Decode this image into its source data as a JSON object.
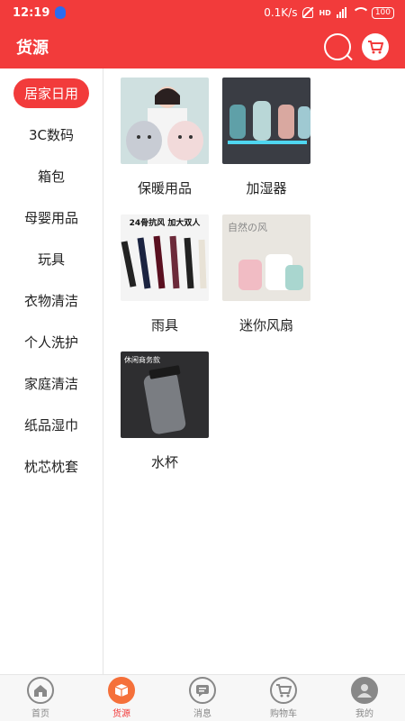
{
  "status_bar": {
    "time": "12:19",
    "network_speed": "0.1K/s",
    "signal": "HD",
    "battery": "100"
  },
  "header": {
    "title": "货源"
  },
  "sidebar": {
    "items": [
      {
        "label": "居家日用",
        "active": true
      },
      {
        "label": "3C数码"
      },
      {
        "label": "箱包"
      },
      {
        "label": "母婴用品"
      },
      {
        "label": "玩具"
      },
      {
        "label": "衣物清洁"
      },
      {
        "label": "个人洗护"
      },
      {
        "label": "家庭清洁"
      },
      {
        "label": "纸品湿巾"
      },
      {
        "label": "枕芯枕套"
      }
    ]
  },
  "products": [
    {
      "label": "保暖用品"
    },
    {
      "label": "加湿器"
    },
    {
      "label": "雨具",
      "image_text": "24骨抗风 加大双人"
    },
    {
      "label": "迷你风扇",
      "image_text": "自然の风"
    },
    {
      "label": "水杯",
      "image_text": "休闲商务款"
    }
  ],
  "tabbar": {
    "items": [
      {
        "label": "首页"
      },
      {
        "label": "货源",
        "active": true
      },
      {
        "label": "消息"
      },
      {
        "label": "购物车"
      },
      {
        "label": "我的"
      }
    ]
  },
  "colors": {
    "brand_red": "#f23b3b",
    "active_tab_orange": "#f5703a"
  }
}
